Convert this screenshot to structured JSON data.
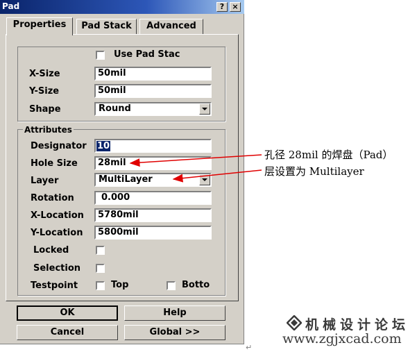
{
  "window": {
    "title": "Pad",
    "help_btn": "?",
    "close_btn": "×"
  },
  "tabs": [
    {
      "label": "Properties",
      "active": true
    },
    {
      "label": "Pad Stack",
      "active": false
    },
    {
      "label": "Advanced",
      "active": false
    }
  ],
  "pad": {
    "use_pad_stack_label": "Use Pad Stac",
    "use_pad_stack_checked": false,
    "x_size_label": "X-Size",
    "x_size_value": "50mil",
    "y_size_label": "Y-Size",
    "y_size_value": "50mil",
    "shape_label": "Shape",
    "shape_value": "Round"
  },
  "attributes": {
    "legend": "Attributes",
    "designator_label": "Designator",
    "designator_value": "10",
    "hole_size_label": "Hole Size",
    "hole_size_value": "28mil",
    "layer_label": "Layer",
    "layer_value": "MultiLayer",
    "rotation_label": "Rotation",
    "rotation_value": "0.000",
    "x_location_label": "X-Location",
    "x_location_value": "5780mil",
    "y_location_label": "Y-Location",
    "y_location_value": "5800mil",
    "locked_label": "Locked",
    "locked_checked": false,
    "selection_label": "Selection",
    "selection_checked": false,
    "testpoint_label": "Testpoint",
    "top_label": "Top",
    "top_checked": false,
    "bottom_label": "Botto",
    "bottom_checked": false
  },
  "buttons": {
    "ok": "OK",
    "help": "Help",
    "cancel": "Cancel",
    "global": "Global >>"
  },
  "annotations": {
    "hole_note": "孔径 28mil 的焊盘（Pad）",
    "layer_note": "层设置为 Multilayer",
    "arrow_color": "#e00000"
  },
  "watermark": {
    "name": "机械设计论坛",
    "url": "www.zgjxcad.com"
  },
  "icons": {
    "dropdown": "chevron-down-icon",
    "logo": "diamond-logo-icon"
  }
}
